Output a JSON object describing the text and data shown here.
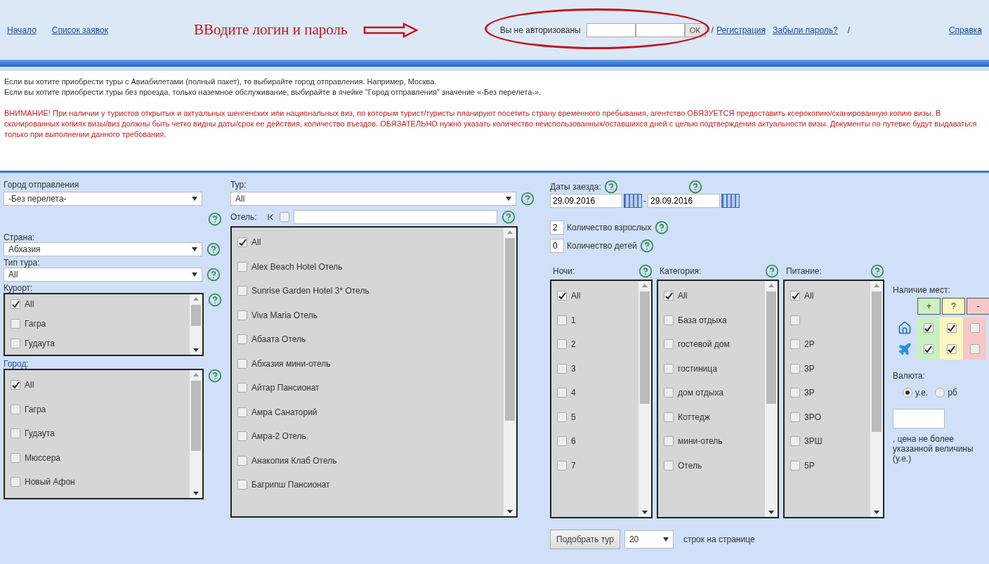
{
  "nav": {
    "links": [
      {
        "label": "Начало"
      },
      {
        "label": "Список заявок"
      }
    ],
    "annotation": "ВВодите логин и пароль",
    "auth_status": "Вы не авторизованы",
    "ok_button": "OK",
    "right_items": [
      {
        "kind": "sep",
        "text": "/"
      },
      {
        "kind": "link",
        "text": "Регистрация"
      },
      {
        "kind": "link",
        "text": "Забыли пароль?"
      },
      {
        "kind": "sep",
        "text": "/"
      },
      {
        "kind": "link",
        "text": "Справка"
      }
    ]
  },
  "info": {
    "lines": [
      "Если вы хотите приобрести туры с Авиабилетами (полный пакет), то выбирайте город отправления. Например, Москва.",
      "Если вы хотите приобрести туры без проезда, только наземное обслуживание, выбирайте в ячейке \"Город отправления\" значение «-Без перелета-»."
    ],
    "warning": "ВНИМАНИЕ! При наличии у туристов открытых и актуальных шенгенских или национальных виз, по которым турист/туристы планируют посетить страну временного пребывания, агентство ОБЯЗУЕТСЯ предоставить ксерокопию/сканированную копию визы. В сканированных копиях визы/виз должны быть четко видны даты/срок ее действия, количество въездов. ОБЯЗАТЕЛЬНО нужно указать количество неиспользованных/оставшихся дней с целью подтверждения актуальности визы. Документы по путевке будут выдаваться только при выполнении данного требования."
  },
  "departure": {
    "label": "Город отправления",
    "value": "-Без перелета-"
  },
  "country": {
    "label": "Страна:",
    "value": "Абхазия"
  },
  "tour_type": {
    "label": "Тип тура:",
    "value": "All"
  },
  "resort": {
    "label": "Курорт:",
    "items": [
      {
        "label": "All",
        "checked": true
      },
      {
        "label": "Гагра",
        "checked": false
      },
      {
        "label": "Гудаута",
        "checked": false
      }
    ]
  },
  "city": {
    "label": "Город:",
    "items": [
      {
        "label": "All",
        "checked": true
      },
      {
        "label": "Гагра",
        "checked": false
      },
      {
        "label": "Гудаута",
        "checked": false
      },
      {
        "label": "Мюссера",
        "checked": false
      },
      {
        "label": "Новый Афон",
        "checked": false
      }
    ]
  },
  "tour": {
    "label": "Тур:",
    "value": "All"
  },
  "hotel": {
    "label": "Отель:",
    "filter_checked": false,
    "items": [
      {
        "label": "All",
        "checked": true
      },
      {
        "label": "Alex Beach Hotel Отель",
        "checked": false
      },
      {
        "label": "Sunrise Garden Hotel 3* Отель",
        "checked": false
      },
      {
        "label": "Viva Maria Отель",
        "checked": false
      },
      {
        "label": "Абаата Отель",
        "checked": false
      },
      {
        "label": "Абхазия мини-отель",
        "checked": false
      },
      {
        "label": "Айтар Пансионат",
        "checked": false
      },
      {
        "label": "Амра Санаторий",
        "checked": false
      },
      {
        "label": "Амра-2 Отель",
        "checked": false
      },
      {
        "label": "Анакопия Клаб Отель",
        "checked": false
      },
      {
        "label": "Багрипш Пансионат",
        "checked": false
      }
    ]
  },
  "dates": {
    "label": "Даты заезда:",
    "from": "29.09.2016",
    "separator": "-",
    "to": "29.09.2016"
  },
  "adults": {
    "value": "2",
    "label": "Количество взрослых"
  },
  "children": {
    "value": "0",
    "label": "Количество детей"
  },
  "nights": {
    "label": "Ночи:",
    "items": [
      {
        "label": "All",
        "checked": true
      },
      {
        "label": "1",
        "checked": false
      },
      {
        "label": "2",
        "checked": false
      },
      {
        "label": "3",
        "checked": false
      },
      {
        "label": "4",
        "checked": false
      },
      {
        "label": "5",
        "checked": false
      },
      {
        "label": "6",
        "checked": false
      },
      {
        "label": "7",
        "checked": false
      }
    ]
  },
  "category": {
    "label": "Категория:",
    "items": [
      {
        "label": "All",
        "checked": true
      },
      {
        "label": "База отдыха",
        "checked": false
      },
      {
        "label": "гостевой дом",
        "checked": false
      },
      {
        "label": "гостиница",
        "checked": false
      },
      {
        "label": "дом отдыха",
        "checked": false
      },
      {
        "label": "Коттедж",
        "checked": false
      },
      {
        "label": "мини-отель",
        "checked": false
      },
      {
        "label": "Отель",
        "checked": false
      }
    ]
  },
  "meals": {
    "label": "Питание:",
    "items": [
      {
        "label": "All",
        "checked": true
      },
      {
        "checked": false
      },
      {
        "label": "2P",
        "checked": false
      },
      {
        "label": "3P",
        "checked": false
      },
      {
        "label": "3P",
        "checked": false
      },
      {
        "label": "3PO",
        "checked": false
      },
      {
        "label": "3PШ",
        "checked": false
      },
      {
        "label": "5P",
        "checked": false
      }
    ]
  },
  "availability": {
    "label": "Наличие мест:",
    "columns": [
      {
        "text": "+",
        "color": "#c8f0c0"
      },
      {
        "text": "?",
        "color": "#fbf7c0"
      },
      {
        "text": "-",
        "color": "#f8c8c8"
      }
    ],
    "rows": [
      {
        "kind": "house",
        "checks": [
          true,
          true,
          false
        ]
      },
      {
        "kind": "plane",
        "checks": [
          true,
          true,
          false
        ]
      }
    ]
  },
  "currency": {
    "label": "Валюта:",
    "options": [
      {
        "label": "у.е.",
        "selected": true
      },
      {
        "label": "рб",
        "selected": false
      }
    ]
  },
  "price_note": ", цена не более указанной величины (у.е.)",
  "search_button": "Подобрать тур",
  "rows_per_page": "20",
  "rows_label": "строк на странице"
}
